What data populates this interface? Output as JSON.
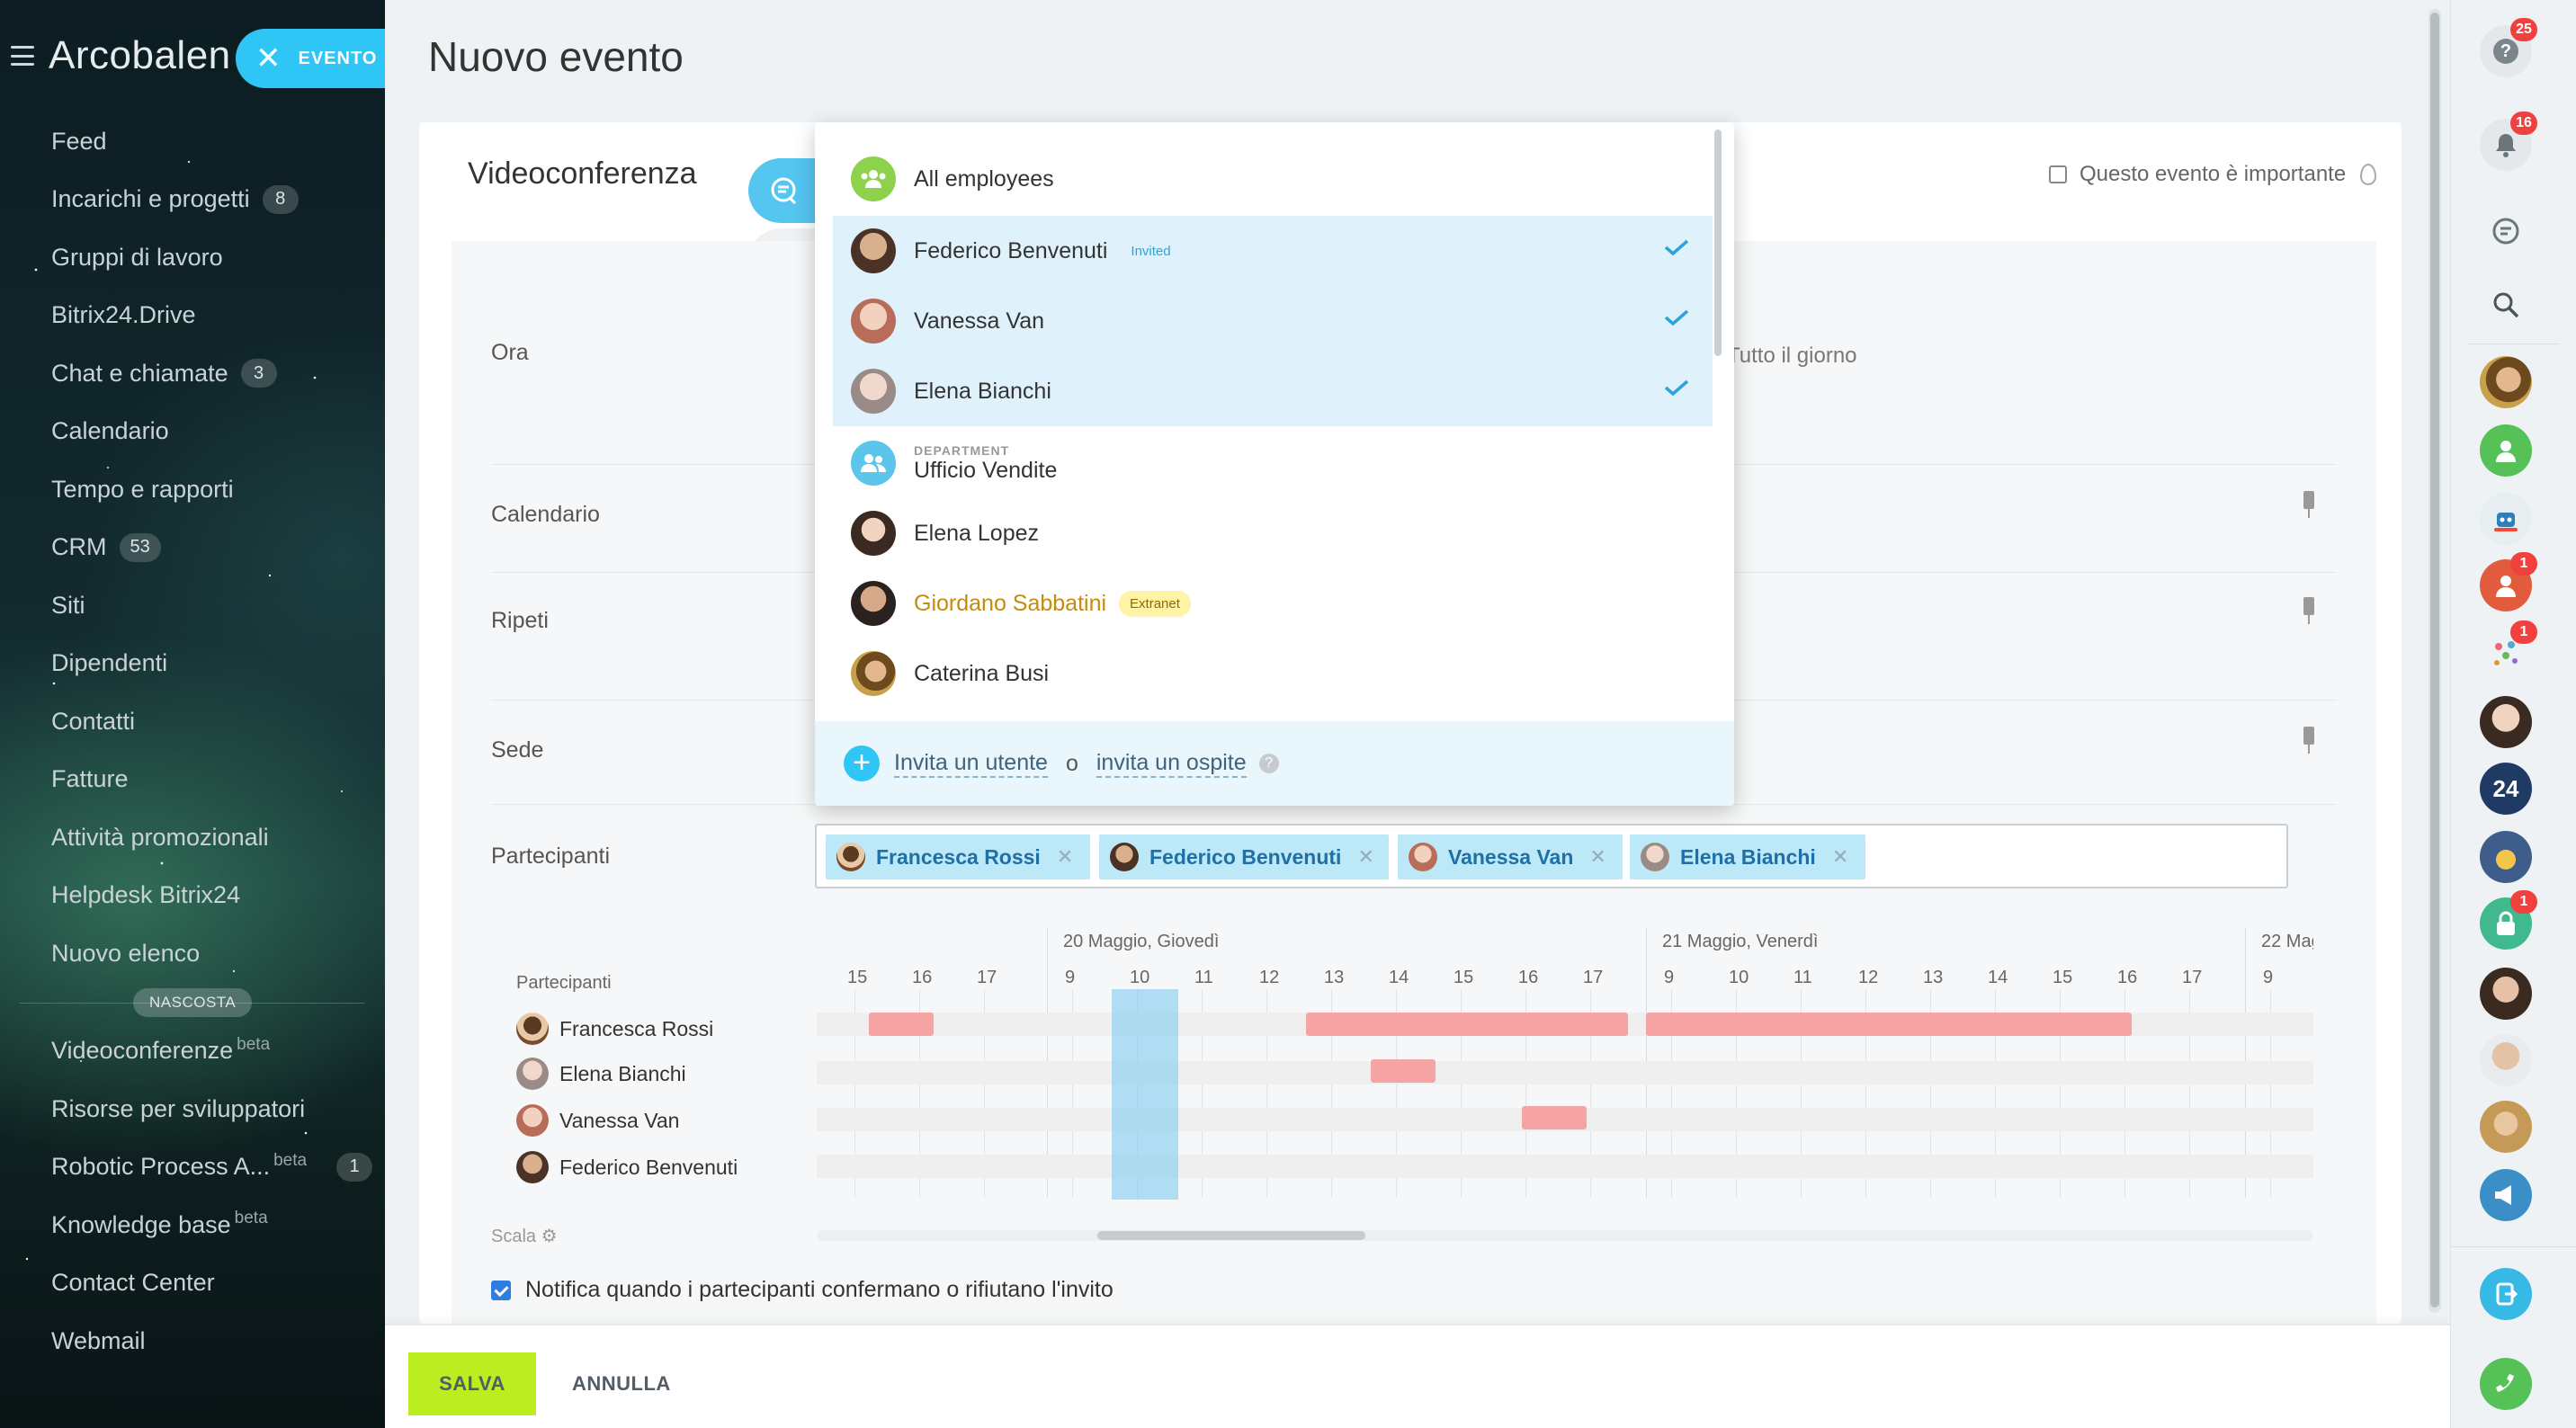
{
  "brand": {
    "name": "Arcobalen",
    "chip_label": "EVENTO"
  },
  "sidebar": {
    "items": [
      {
        "label": "Feed",
        "count": ""
      },
      {
        "label": "Incarichi e progetti",
        "count": "8"
      },
      {
        "label": "Gruppi di lavoro",
        "count": ""
      },
      {
        "label": "Bitrix24.Drive",
        "count": ""
      },
      {
        "label": "Chat e chiamate",
        "count": "3"
      },
      {
        "label": "Calendario",
        "count": ""
      },
      {
        "label": "Tempo e rapporti",
        "count": ""
      },
      {
        "label": "CRM",
        "count": "53"
      },
      {
        "label": "Siti",
        "count": ""
      },
      {
        "label": "Dipendenti",
        "count": ""
      },
      {
        "label": "Contatti",
        "count": ""
      },
      {
        "label": "Fatture",
        "count": ""
      },
      {
        "label": "Attività promozionali",
        "count": ""
      },
      {
        "label": "Helpdesk Bitrix24",
        "count": ""
      },
      {
        "label": "Nuovo elenco",
        "count": ""
      }
    ],
    "separator_label": "NASCOSTA",
    "hidden_items": [
      {
        "label": "Videoconferenze",
        "sup": "beta",
        "count": ""
      },
      {
        "label": "Risorse per sviluppatori",
        "sup": "",
        "count": ""
      },
      {
        "label": "Robotic Process A...",
        "sup": "beta",
        "count": "1"
      },
      {
        "label": "Knowledge base",
        "sup": "beta",
        "count": ""
      },
      {
        "label": "Contact Center",
        "sup": "",
        "count": ""
      },
      {
        "label": "Webmail",
        "sup": "",
        "count": ""
      }
    ]
  },
  "page": {
    "title": "Nuovo evento"
  },
  "event": {
    "type_label": "Videoconferenza",
    "important_label": "Questo evento è importante",
    "allday_label": "Tutto il giorno",
    "rows": {
      "time": "Ora",
      "calendar": "Calendario",
      "repeat": "Ripeti",
      "location": "Sede",
      "participants": "Partecipanti"
    }
  },
  "dropdown": {
    "all_employees": "All employees",
    "items": [
      {
        "name": "Federico Benvenuti",
        "tag": "Invited",
        "selected": true
      },
      {
        "name": "Vanessa Van",
        "tag": "",
        "selected": true
      },
      {
        "name": "Elena Bianchi",
        "tag": "",
        "selected": true
      }
    ],
    "department": {
      "caption": "DEPARTMENT",
      "name": "Ufficio Vendite"
    },
    "others": [
      {
        "name": "Elena Lopez",
        "tag": ""
      },
      {
        "name": "Giordano Sabbatini",
        "tag": "Extranet"
      },
      {
        "name": "Caterina Busi",
        "tag": ""
      }
    ],
    "footer": {
      "invite_user": "Invita un utente",
      "or": "o",
      "invite_guest": "invita un ospite",
      "help": "?"
    }
  },
  "participants_chips": [
    "Francesca Rossi",
    "Federico Benvenuti",
    "Vanessa Van",
    "Elena Bianchi"
  ],
  "timeline": {
    "column_title": "Partecipanti",
    "days": [
      "20 Maggio, Giovedì",
      "21 Maggio, Venerdì",
      "22 Mag"
    ],
    "hours_pre": [
      "15",
      "16",
      "17"
    ],
    "hours_day1": [
      "9",
      "10",
      "11",
      "12",
      "13",
      "14",
      "15",
      "16",
      "17"
    ],
    "hours_day2": [
      "9",
      "10",
      "11",
      "12",
      "13",
      "14",
      "15",
      "16",
      "17"
    ],
    "hours_day3": [
      "9"
    ],
    "people": [
      "Francesca Rossi",
      "Elena Bianchi",
      "Vanessa Van",
      "Federico Benvenuti"
    ],
    "scale_label": "Scala"
  },
  "notify_label": "Notifica quando i partecipanti confermano o rifiutano l'invito",
  "footer": {
    "save": "SALVA",
    "cancel": "ANNULLA"
  },
  "rightbar": {
    "help_badge": "25",
    "bell_badge": "16",
    "b24_label": "24",
    "badge_one": "1"
  },
  "colors": {
    "accent": "#2fc6f6",
    "save": "#bbed21",
    "busy": "#f5a3a3",
    "chip_bg": "#bde8f8",
    "chip_text": "#1f70a6",
    "extranet": "#c58b10"
  }
}
